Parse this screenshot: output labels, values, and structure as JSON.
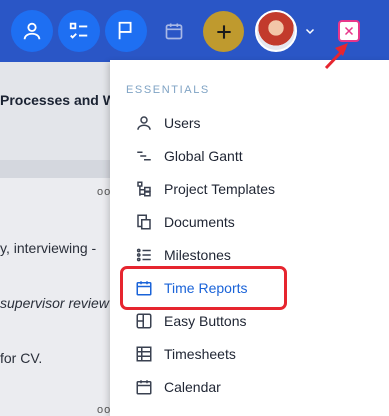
{
  "topbar": {
    "buttons": [
      {
        "name": "profile-button",
        "icon": "user-icon"
      },
      {
        "name": "tasks-button",
        "icon": "checklist-icon"
      },
      {
        "name": "flag-button",
        "icon": "flag-icon"
      }
    ],
    "calendar_icon": "calendar-icon",
    "add_icon": "plus-icon",
    "close_icon": "close-icon"
  },
  "background": {
    "heading": "Processes and W",
    "lines": [
      "y, interviewing -",
      "supervisor review",
      "for CV."
    ]
  },
  "menu": {
    "section_label": "ESSENTIALS",
    "items": [
      {
        "label": "Users",
        "icon": "user-icon"
      },
      {
        "label": "Global Gantt",
        "icon": "gantt-icon"
      },
      {
        "label": "Project Templates",
        "icon": "template-icon"
      },
      {
        "label": "Documents",
        "icon": "documents-icon"
      },
      {
        "label": "Milestones",
        "icon": "milestones-icon"
      },
      {
        "label": "Time Reports",
        "icon": "calendar-icon"
      },
      {
        "label": "Easy Buttons",
        "icon": "easy-buttons-icon"
      },
      {
        "label": "Timesheets",
        "icon": "timesheet-icon"
      },
      {
        "label": "Calendar",
        "icon": "calendar-icon"
      }
    ]
  },
  "colors": {
    "topbar": "#2a56c6",
    "button": "#1e6ff2",
    "plus": "#bf9a2e",
    "accent": "#1a63d8",
    "highlight": "#e6252f",
    "close": "#e8368a"
  }
}
